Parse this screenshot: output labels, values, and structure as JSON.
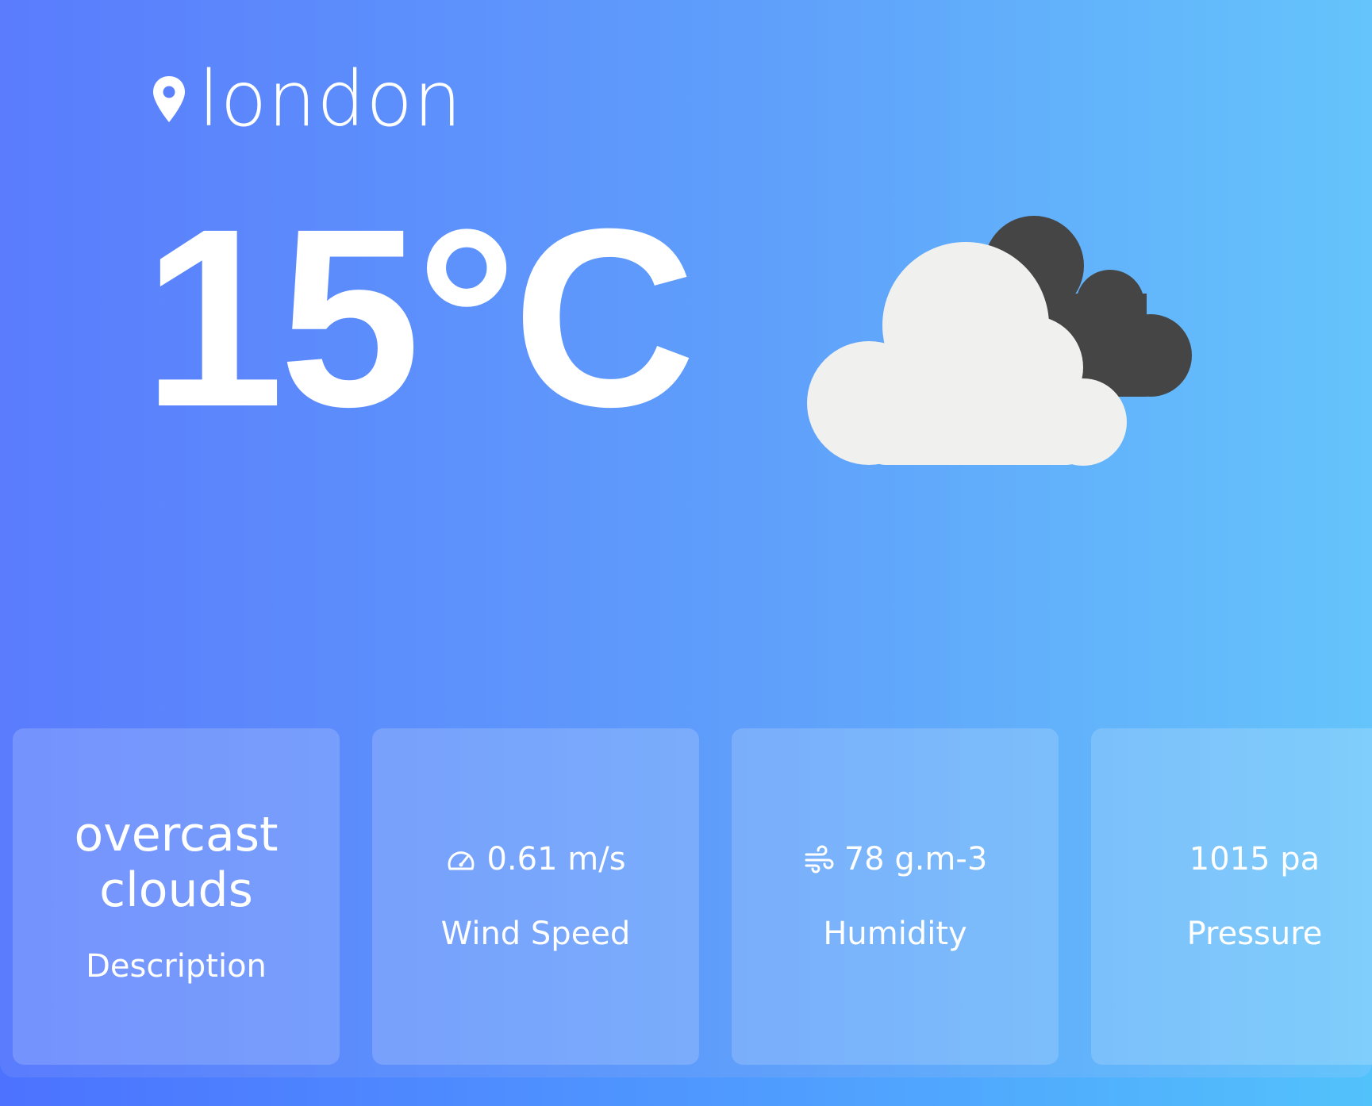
{
  "location": {
    "icon": "location-pin-icon",
    "city": "london"
  },
  "weather": {
    "temperature": "15°C",
    "icon": "clouds-icon"
  },
  "stats": {
    "description": {
      "line1": "overcast",
      "line2": "clouds",
      "label": "Description"
    },
    "wind": {
      "icon": "speedometer-icon",
      "value": "0.61 m/s",
      "label": "Wind Speed"
    },
    "humidity": {
      "icon": "wind-icon",
      "value": "78 g.m-3",
      "label": "Humidity"
    },
    "pressure": {
      "value": "1015 pa",
      "label": "Pressure"
    }
  },
  "colors": {
    "gradient_start": "#5a7cfd",
    "gradient_end": "#65c4fb",
    "text": "#ffffff",
    "cloud_light": "#f0f0ee",
    "cloud_dark": "#454545"
  }
}
